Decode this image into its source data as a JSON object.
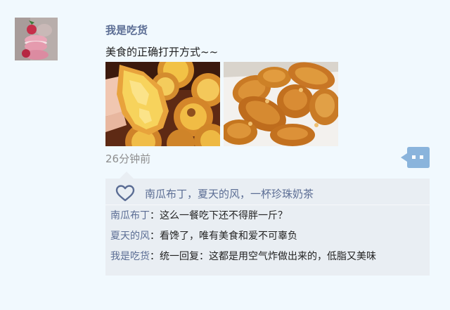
{
  "post": {
    "username": "我是吃货",
    "content": "美食的正确打开方式~~",
    "timestamp": "26分钟前",
    "images": [
      {
        "subject": "egg-tart"
      },
      {
        "subject": "fried-chicken-wings"
      }
    ]
  },
  "interaction": {
    "likes_text": "南瓜布丁，夏天的风，一杯珍珠奶茶",
    "comments": [
      {
        "user": "南瓜布丁",
        "separator": "：",
        "text": "这么一餐吃下还不得胖一斤？"
      },
      {
        "user": "夏天的风",
        "separator": "：",
        "text": "看馋了，唯有美食和爱不可辜负"
      },
      {
        "user": "我是吃货",
        "separator": "：",
        "text": "统一回复：这都是用空气炸做出来的，低脂又美味"
      }
    ]
  },
  "colors": {
    "background": "#f1f9fe",
    "accent": "#5b6d94",
    "panel": "#e9eef3",
    "comment_button": "#8ab4dc"
  },
  "icons": [
    "heart-icon",
    "comment-icon"
  ]
}
